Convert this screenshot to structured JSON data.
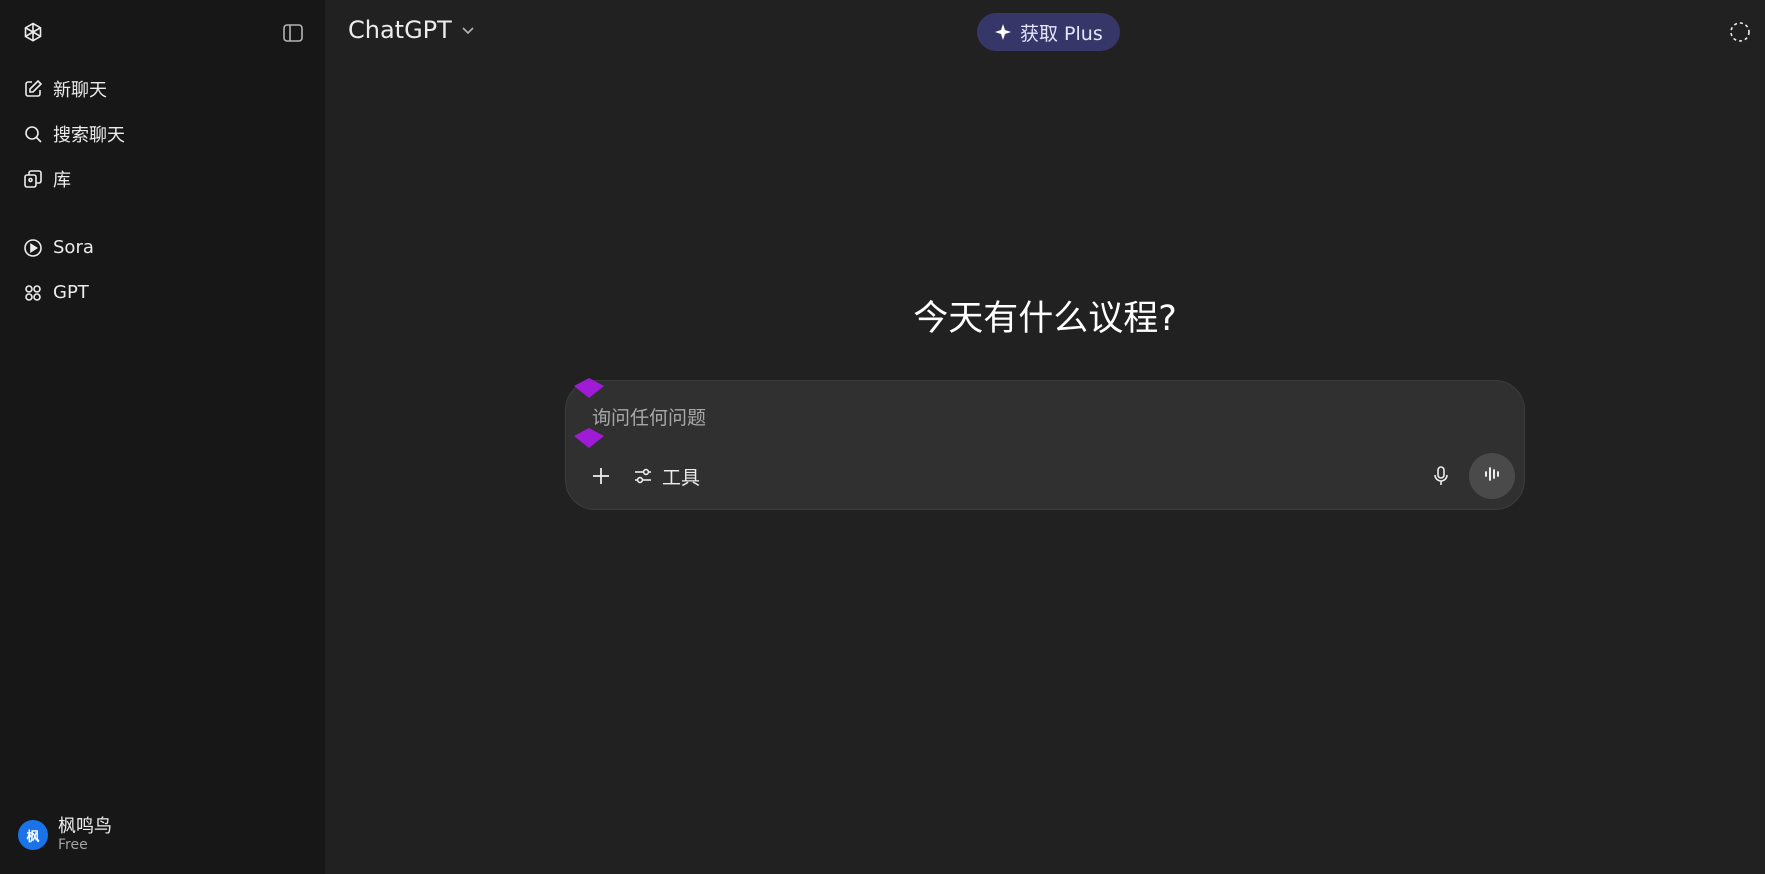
{
  "sidebar": {
    "logo_icon": "openai-logo-icon",
    "toggle_icon": "sidebar-toggle-icon",
    "items": [
      {
        "label": "新聊天",
        "icon": "new-chat-icon"
      },
      {
        "label": "搜索聊天",
        "icon": "search-icon"
      },
      {
        "label": "库",
        "icon": "library-icon"
      },
      {
        "label": "Sora",
        "icon": "play-circle-icon"
      },
      {
        "label": "GPT",
        "icon": "grid-icon"
      }
    ],
    "user": {
      "avatar_text": "枫",
      "name": "枫鸣鸟",
      "plan": "Free",
      "avatar_color": "#1a73e8"
    }
  },
  "header": {
    "model": "ChatGPT",
    "upgrade_label": "获取 Plus",
    "upgrade_color": "#373669"
  },
  "main": {
    "headline": "今天有什么议程?",
    "composer": {
      "placeholder": "询问任何问题",
      "tools_label": "工具",
      "marker_color": "#a01bd6"
    }
  }
}
